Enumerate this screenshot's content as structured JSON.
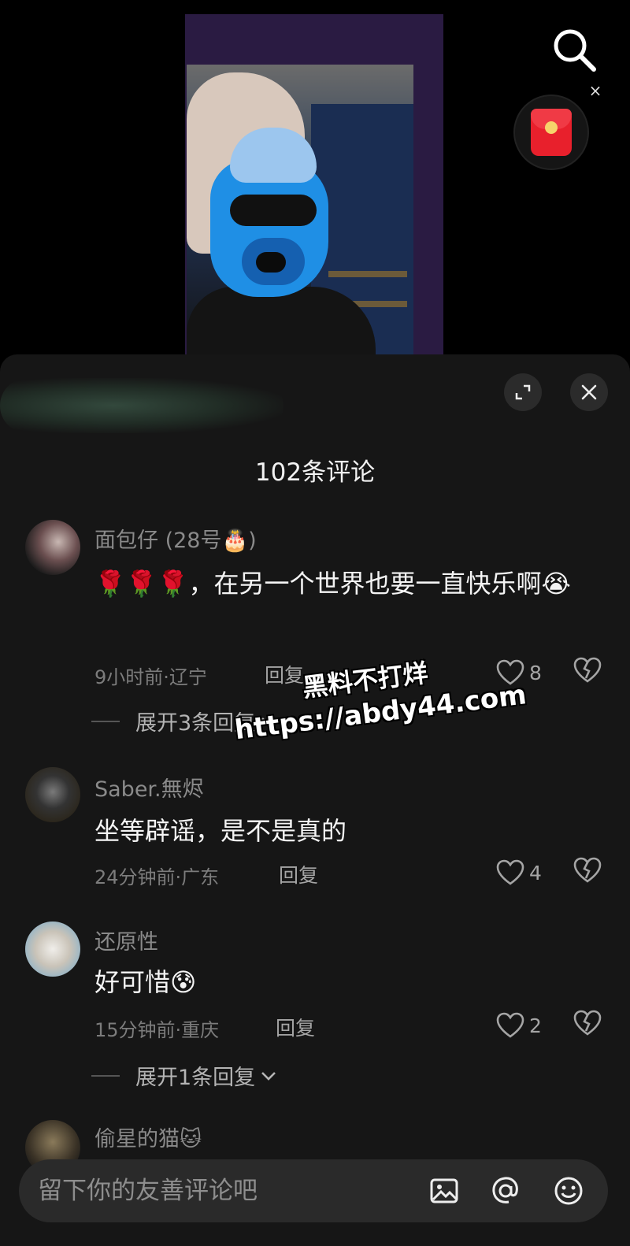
{
  "comments_sheet": {
    "title": "102条评论"
  },
  "comments": [
    {
      "username": "面包仔 (28号🎂)",
      "text": "🌹🌹🌹，在另一个世界也要一直快乐啊😭",
      "meta": "9小时前·辽宁",
      "reply_label": "回复",
      "likes": "8",
      "expand_label": "展开3条回复"
    },
    {
      "username": "Saber.無烬",
      "text": "坐等辟谣，是不是真的",
      "meta": "24分钟前·广东",
      "reply_label": "回复",
      "likes": "4"
    },
    {
      "username": "还原性",
      "text": "好可惜😰",
      "meta": "15分钟前·重庆",
      "reply_label": "回复",
      "likes": "2",
      "expand_label": "展开1条回复"
    },
    {
      "username": "偷星的猫🐱"
    }
  ],
  "watermark": {
    "line1": "黑料不打烊",
    "line2": "https://abdy44.com"
  },
  "input": {
    "placeholder": "留下你的友善评论吧"
  },
  "colors": {
    "sheet_bg": "#161616",
    "redpacket": "#e8202c",
    "mask_blue": "#1f8fe5"
  }
}
